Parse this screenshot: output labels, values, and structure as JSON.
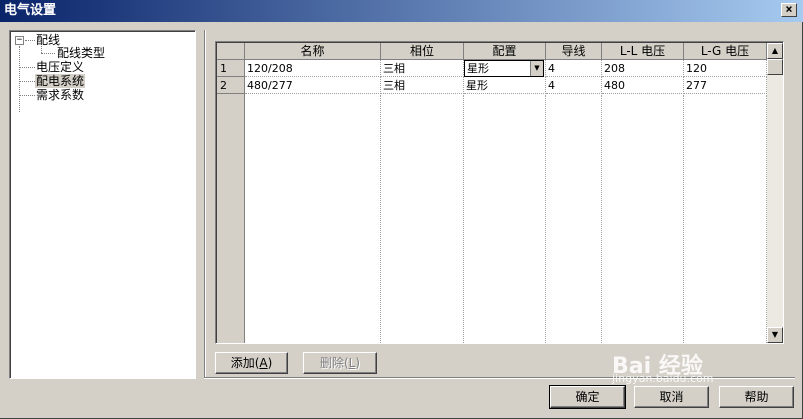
{
  "window": {
    "title": "电气设置",
    "close_glyph": "×"
  },
  "tree": {
    "expander_glyph": "−",
    "items": [
      {
        "label": "配线"
      },
      {
        "label": "配线类型"
      },
      {
        "label": "电压定义"
      },
      {
        "label": "配电系统",
        "selected": true
      },
      {
        "label": "需求系数"
      }
    ]
  },
  "grid": {
    "columns": [
      "名称",
      "相位",
      "配置",
      "导线",
      "L-L 电压",
      "L-G 电压"
    ],
    "rows": [
      {
        "num": "1",
        "cells": [
          "120/208",
          "三相",
          "星形",
          "4",
          "208",
          "120"
        ]
      },
      {
        "num": "2",
        "cells": [
          "480/277",
          "三相",
          "星形",
          "4",
          "480",
          "277"
        ]
      }
    ],
    "combo_arrow": "▼",
    "scroll_up": "▲",
    "scroll_down": "▼"
  },
  "actions": {
    "add": "添加",
    "add_key": "A",
    "delete": "删除",
    "delete_key": "L"
  },
  "footer": {
    "ok": "确定",
    "cancel": "取消",
    "help": "帮助"
  },
  "watermark": {
    "brand": "Bai 经验",
    "url": "jingyan.baidu.com"
  }
}
